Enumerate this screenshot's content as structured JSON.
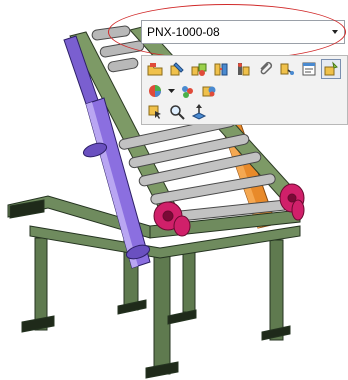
{
  "configuration": {
    "selected": "PNX-1000-08"
  },
  "toolbar": {
    "row1": [
      "open-part-icon",
      "edit-part-icon",
      "assembly-icon",
      "mate-icon",
      "component-icon",
      "paperclip-icon",
      "linked-part-icon",
      "properties-icon",
      "smart-icon"
    ],
    "row2": [
      "color-wheel-icon",
      "appearance-icon",
      "render-icon"
    ],
    "row3": [
      "select-icon",
      "zoom-icon",
      "move-axis-icon"
    ]
  }
}
